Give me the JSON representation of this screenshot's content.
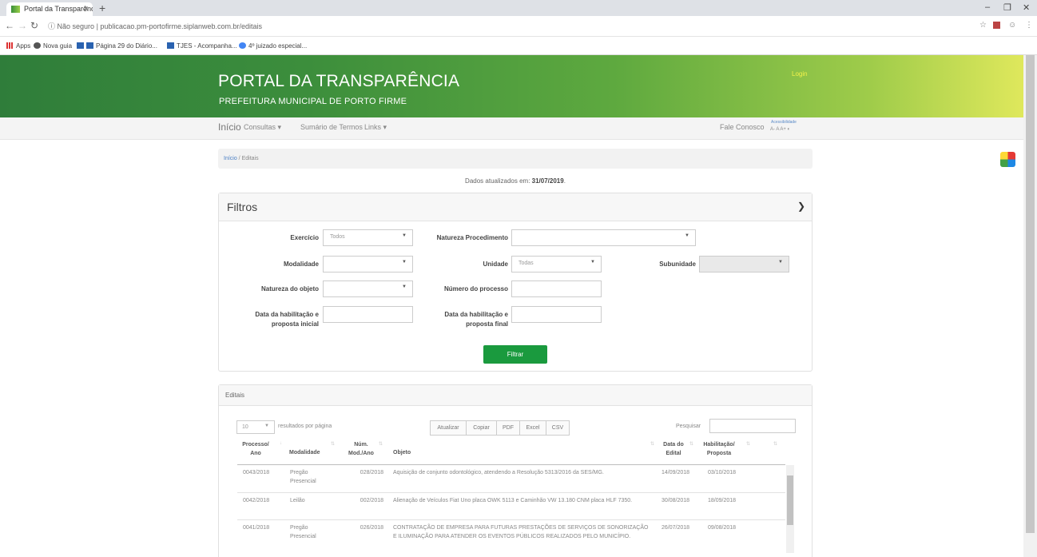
{
  "browser": {
    "tab_title": "Portal da Transparência - Atas",
    "tab_close": "x",
    "new_tab": "+",
    "url_security": "Não seguro",
    "url_text": "publicacao.pm-portofirme.siplanweb.com.br/editais",
    "bookmarks": [
      "Apps",
      "Nova guia",
      "Página 29 do Diário...",
      "TJES - Acompanha...",
      "4º juizado especial..."
    ]
  },
  "banner": {
    "title": "PORTAL DA TRANSPARÊNCIA",
    "subtitle": "PREFEITURA MUNICIPAL DE PORTO FIRME",
    "login": "Login"
  },
  "nav": {
    "home": "Início",
    "items": [
      "Consultas ▾",
      "Sumário de Termos",
      "Links ▾"
    ],
    "contact": "Fale Conosco",
    "accessibility_label": "Acessibilidade",
    "accessibility": "A-  A  A+  ◐"
  },
  "breadcrumb": {
    "home": "Início",
    "sep": " / ",
    "current": "Editais"
  },
  "updated": {
    "prefix": "Dados atualizados em: ",
    "date": "31/07/2019",
    "suffix": "."
  },
  "filters": {
    "title": "Filtros",
    "exercicio_label": "Exercício",
    "exercicio_value": "Todos",
    "natureza_proc_label": "Natureza Procedimento",
    "modalidade_label": "Modalidade",
    "unidade_label": "Unidade",
    "unidade_value": "Todas",
    "subunidade_label": "Subunidade",
    "natureza_obj_label": "Natureza do objeto",
    "num_processo_label": "Número do processo",
    "data_ini_label": "Data da habilitação e proposta inicial",
    "data_fim_label": "Data da habilitação e proposta final",
    "filtrar": "Filtrar"
  },
  "editais": {
    "title": "Editais",
    "page_len": "10",
    "page_len_text": "resultados por página",
    "buttons": [
      "Atualizar",
      "Copiar",
      "PDF",
      "Excel",
      "CSV"
    ],
    "search_label": "Pesquisar",
    "columns": [
      "Processo/ Ano",
      "Modalidade",
      "Núm. Mod./Ano",
      "Objeto",
      "Data do Edital",
      "Habilitação/ Proposta"
    ],
    "rows": [
      {
        "processo": "0043/2018",
        "modalidade": "Pregão Presencial",
        "num": "028/2018",
        "objeto": "Aquisição de conjunto odontológico, atendendo a Resolução 5313/2016 da SES/MG.",
        "data": "14/09/2018",
        "habilitacao": "03/10/2018"
      },
      {
        "processo": "0042/2018",
        "modalidade": "Leilão",
        "num": "002/2018",
        "objeto": "Alienação de Veículos Fiat Uno placa OWK 5113 e Caminhão VW 13.180 CNM placa HLF 7350.",
        "data": "30/08/2018",
        "habilitacao": "18/09/2018"
      },
      {
        "processo": "0041/2018",
        "modalidade": "Pregão Presencial",
        "num": "026/2018",
        "objeto": "CONTRATAÇÃO DE EMPRESA PARA FUTURAS PRESTAÇÕES DE SERVIÇOS DE SONORIZAÇÃO E ILUMINAÇÃO PARA ATENDER OS EVENTOS PÚBLICOS REALIZADOS PELO MUNICÍPIO.",
        "data": "26/07/2018",
        "habilitacao": "09/08/2018"
      }
    ]
  }
}
